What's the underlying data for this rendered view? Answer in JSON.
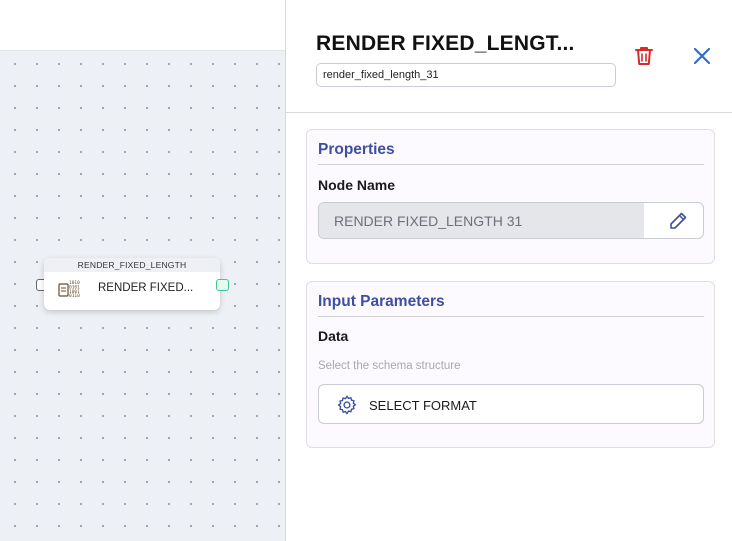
{
  "canvas": {
    "node": {
      "header": "RENDER_FIXED_LENGTH",
      "label": "RENDER FIXED...",
      "icon": "binary-document-icon"
    }
  },
  "panel": {
    "title": "RENDER FIXED_LENGT...",
    "node_id_value": "render_fixed_length_31",
    "delete_icon": "trash-icon",
    "close_icon": "close-icon",
    "properties": {
      "title": "Properties",
      "node_name_label": "Node Name",
      "node_name_value": "RENDER FIXED_LENGTH 31",
      "edit_icon": "pencil-icon"
    },
    "input_parameters": {
      "title": "Input Parameters",
      "data_label": "Data",
      "hint": "Select the schema structure",
      "select_button_label": "SELECT FORMAT",
      "select_icon": "gear-icon"
    }
  },
  "colors": {
    "accent": "#3f4fa0",
    "delete": "#d92b2b",
    "close": "#2f6fc9",
    "port_out": "#3fc79a",
    "canvas_bg": "#edf0f4"
  }
}
